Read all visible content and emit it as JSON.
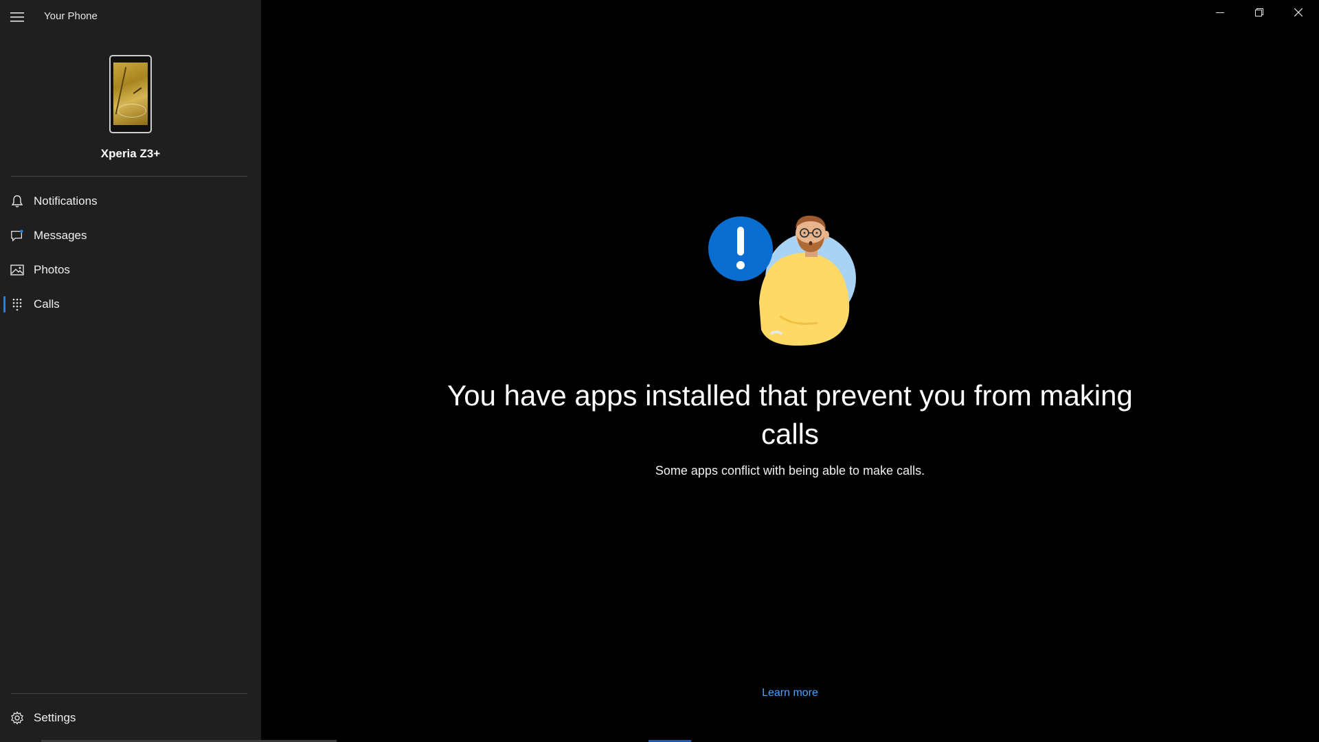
{
  "window": {
    "title": "Your Phone",
    "controls": [
      "minimize-icon",
      "restore-icon",
      "close-icon"
    ]
  },
  "sidebar": {
    "phone_name": "Xperia Z3+",
    "items": [
      {
        "label": "Notifications",
        "icon": "bell-icon",
        "active": false
      },
      {
        "label": "Messages",
        "icon": "message-icon",
        "active": false
      },
      {
        "label": "Photos",
        "icon": "photos-icon",
        "active": false
      },
      {
        "label": "Calls",
        "icon": "dialpad-icon",
        "active": true
      }
    ],
    "settings_label": "Settings"
  },
  "main": {
    "headline": "You have apps installed that prevent you from making calls",
    "subtext": "Some apps conflict with being able to make calls.",
    "learn_more": "Learn more"
  },
  "colors": {
    "sidebar_bg": "#1f1f1f",
    "main_bg": "#000000",
    "accent": "#2b7fd6",
    "link": "#4aa3ff",
    "alert_blue": "#0a6ed1",
    "illustration_yellow": "#ffd966"
  }
}
